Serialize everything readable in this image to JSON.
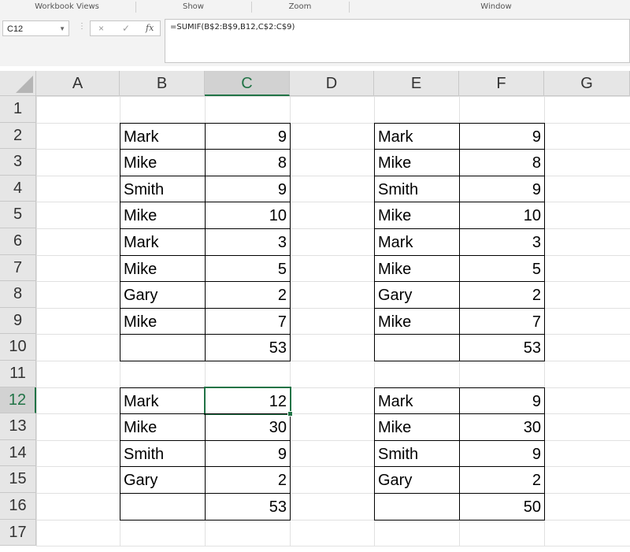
{
  "ribbon": {
    "groups": [
      "Workbook Views",
      "Show",
      "Zoom",
      "Window"
    ]
  },
  "formula_bar": {
    "name_box": "C12",
    "cancel_icon": "×",
    "enter_icon": "✓",
    "fx_label": "fx",
    "formula": "=SUMIF(B$2:B$9,B12,C$2:C$9)"
  },
  "sheet": {
    "columns": [
      "A",
      "B",
      "C",
      "D",
      "E",
      "F",
      "G"
    ],
    "rows": [
      "1",
      "2",
      "3",
      "4",
      "5",
      "6",
      "7",
      "8",
      "9",
      "10",
      "11",
      "12",
      "13",
      "14",
      "15",
      "16",
      "17"
    ],
    "active_cell": "C12",
    "table_left": [
      [
        "Mark",
        "9"
      ],
      [
        "Mike",
        "8"
      ],
      [
        "Smith",
        "9"
      ],
      [
        "Mike",
        "10"
      ],
      [
        "Mark",
        "3"
      ],
      [
        "Mike",
        "5"
      ],
      [
        "Gary",
        "2"
      ],
      [
        "Mike",
        "7"
      ],
      [
        "",
        "53"
      ],
      [
        "",
        ""
      ],
      [
        "Mark",
        "12"
      ],
      [
        "Mike",
        "30"
      ],
      [
        "Smith",
        "9"
      ],
      [
        "Gary",
        "2"
      ],
      [
        "",
        "53"
      ]
    ],
    "table_right": [
      [
        "Mark",
        "9"
      ],
      [
        "Mike",
        "8"
      ],
      [
        "Smith",
        "9"
      ],
      [
        "Mike",
        "10"
      ],
      [
        "Mark",
        "3"
      ],
      [
        "Mike",
        "5"
      ],
      [
        "Gary",
        "2"
      ],
      [
        "Mike",
        "7"
      ],
      [
        "",
        "53"
      ],
      [
        "",
        ""
      ],
      [
        "Mark",
        "9"
      ],
      [
        "Mike",
        "30"
      ],
      [
        "Smith",
        "9"
      ],
      [
        "Gary",
        "2"
      ],
      [
        "",
        "50"
      ]
    ]
  },
  "colors": {
    "accent": "#217346"
  }
}
